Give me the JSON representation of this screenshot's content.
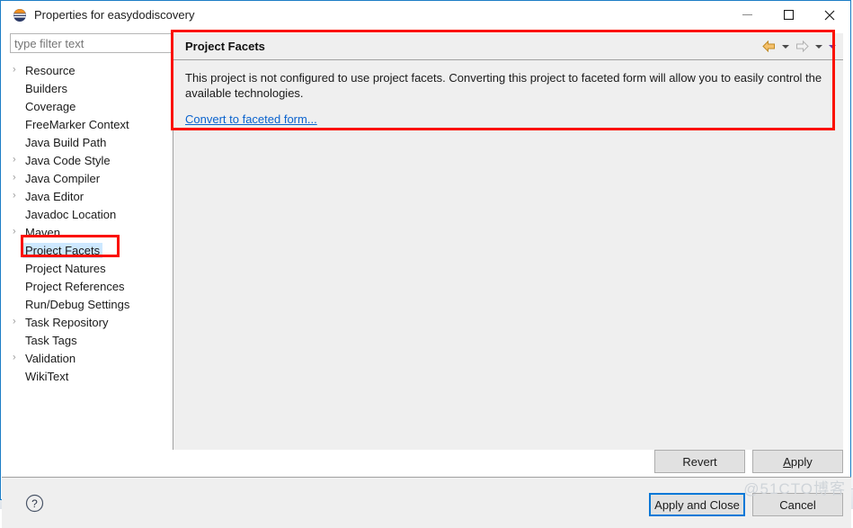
{
  "window": {
    "title": "Properties for easydodiscovery",
    "app_icon": "eclipse-icon",
    "controls": {
      "minimize": "—",
      "maximize": "☐",
      "close": "✕"
    },
    "border_color": "#1d7ec6"
  },
  "sidebar": {
    "filter": {
      "value": "",
      "placeholder": "type filter text"
    },
    "items": [
      {
        "label": "Resource",
        "expandable": true,
        "selected": false
      },
      {
        "label": "Builders",
        "expandable": false,
        "selected": false
      },
      {
        "label": "Coverage",
        "expandable": false,
        "selected": false
      },
      {
        "label": "FreeMarker Context",
        "expandable": false,
        "selected": false
      },
      {
        "label": "Java Build Path",
        "expandable": false,
        "selected": false
      },
      {
        "label": "Java Code Style",
        "expandable": true,
        "selected": false
      },
      {
        "label": "Java Compiler",
        "expandable": true,
        "selected": false
      },
      {
        "label": "Java Editor",
        "expandable": true,
        "selected": false
      },
      {
        "label": "Javadoc Location",
        "expandable": false,
        "selected": false
      },
      {
        "label": "Maven",
        "expandable": true,
        "selected": false
      },
      {
        "label": "Project Facets",
        "expandable": false,
        "selected": true
      },
      {
        "label": "Project Natures",
        "expandable": false,
        "selected": false
      },
      {
        "label": "Project References",
        "expandable": false,
        "selected": false
      },
      {
        "label": "Run/Debug Settings",
        "expandable": false,
        "selected": false
      },
      {
        "label": "Task Repository",
        "expandable": true,
        "selected": false
      },
      {
        "label": "Task Tags",
        "expandable": false,
        "selected": false
      },
      {
        "label": "Validation",
        "expandable": true,
        "selected": false
      },
      {
        "label": "WikiText",
        "expandable": false,
        "selected": false
      }
    ],
    "expand_arrow_glyph": "›",
    "selection_color": "#cde8ff"
  },
  "content": {
    "title": "Project Facets",
    "description": "This project is not configured to use project facets. Converting this project to faceted form will allow you to easily control the available technologies.",
    "link_label": "Convert to faceted form...",
    "link_color": "#0b63ce",
    "nav": {
      "back_icon": "back-arrow-icon",
      "back_caret_icon": "chevron-down-icon",
      "forward_icon": "forward-arrow-icon",
      "forward_caret_icon": "chevron-down-icon",
      "menu_caret_icon": "chevron-down-icon"
    }
  },
  "buttons": {
    "revert": "Revert",
    "apply_prefix": "A",
    "apply_suffix": "pply",
    "apply_and_close": "Apply and Close",
    "cancel": "Cancel"
  },
  "help": {
    "icon": "help-question-icon",
    "glyph": "?"
  },
  "annotations": {
    "color": "#fb1100",
    "content_box": "project-facets-panel-highlight",
    "tree_box": "project-facets-tree-item-highlight"
  },
  "watermark": {
    "text": "@51CTO博客"
  },
  "background": {
    "ghost_text": ""
  }
}
